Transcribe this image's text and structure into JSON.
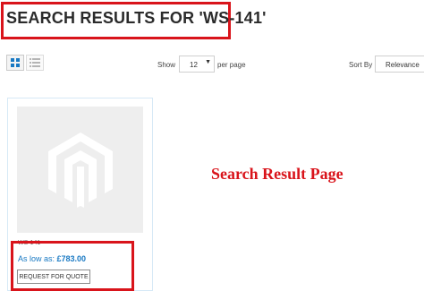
{
  "header": {
    "title": "SEARCH RESULTS FOR 'WS-141'"
  },
  "toolbar": {
    "view_modes": [
      {
        "icon": "grid-icon",
        "active": true
      },
      {
        "icon": "list-icon",
        "active": false
      }
    ],
    "show_label": "Show",
    "limit_value": "12",
    "per_page_label": "per page",
    "sort_label": "Sort By",
    "sort_value": "Relevance"
  },
  "product": {
    "image_icon": "magento-logo-placeholder-icon",
    "sku": "WS-141",
    "price_prefix": "As low as:",
    "price": "£783.00",
    "quote_button": "REQUEST FOR QUOTE"
  },
  "annotation": {
    "text": "Search Result Page"
  },
  "colors": {
    "highlight": "#d9141b",
    "price": "#1979c3",
    "placeholder_bg": "#eeeeee"
  }
}
